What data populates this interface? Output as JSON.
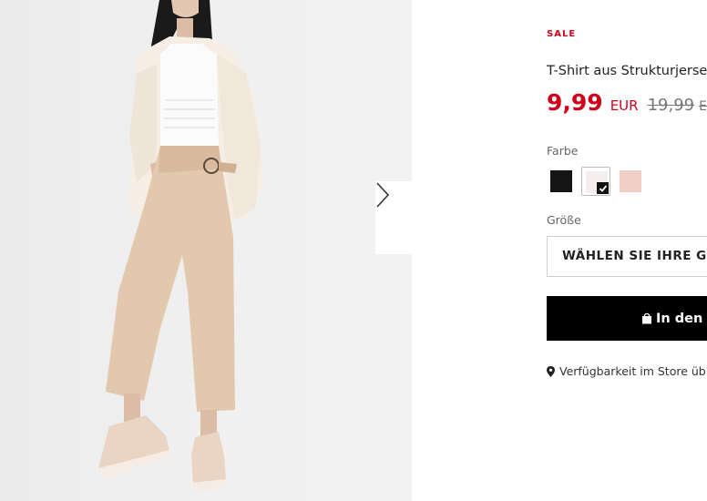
{
  "product": {
    "sale_label": "SALE",
    "title": "T-Shirt aus Strukturjerse",
    "price": {
      "current": "9,99",
      "currency": "EUR",
      "old": "19,99",
      "old_currency": "EU"
    }
  },
  "gallery": {
    "next_icon": "chevron-right-icon"
  },
  "options": {
    "color_label": "Farbe",
    "colors": [
      {
        "name": "black",
        "hex": "#151515",
        "selected": false
      },
      {
        "name": "white",
        "hex": "#f5eeee",
        "selected": true
      },
      {
        "name": "pink",
        "hex": "#f1cfc7",
        "selected": false
      }
    ],
    "size_label": "Größe",
    "size_placeholder": "WÄHLEN SIE IHRE GR"
  },
  "actions": {
    "add_to_cart_label": "In den V",
    "add_to_cart_icon": "shopping-bag-icon",
    "store_availability_label": "Verfügbarkeit im Store üb",
    "store_icon": "map-pin-icon"
  },
  "colors": {
    "sale": "#d0021b",
    "primary_button": "#000000"
  }
}
